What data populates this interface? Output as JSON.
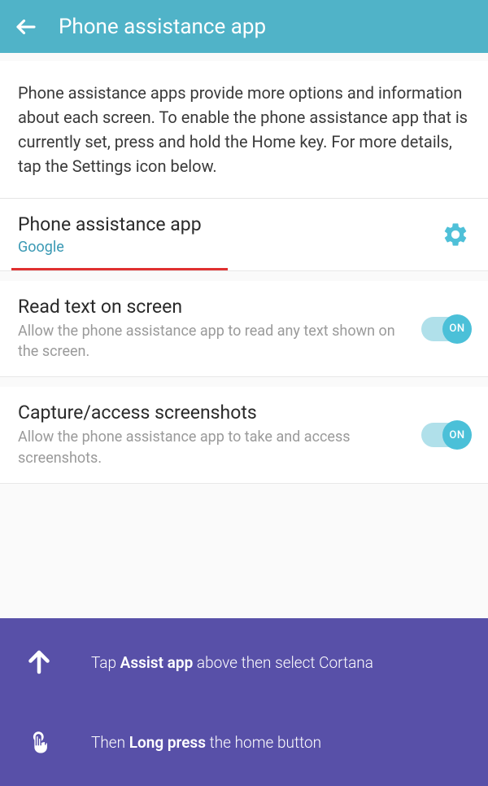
{
  "header": {
    "title": "Phone assistance app"
  },
  "description": "Phone assistance apps provide more options and information about each screen. To enable the phone assistance app that is currently set, press and hold the Home key. For more details, tap the Settings icon below.",
  "rows": {
    "app": {
      "title": "Phone assistance app",
      "value": "Google"
    },
    "read": {
      "title": "Read text on screen",
      "desc": "Allow the phone assistance app to read any text shown on the screen.",
      "toggle": "ON"
    },
    "capture": {
      "title": "Capture/access screenshots",
      "desc": "Allow the phone assistance app to take and access screenshots.",
      "toggle": "ON"
    }
  },
  "footer": {
    "step1_pre": "Tap ",
    "step1_bold": "Assist app",
    "step1_post": " above then select Cortana",
    "step2_pre": "Then ",
    "step2_bold": "Long press",
    "step2_post": " the home button"
  }
}
